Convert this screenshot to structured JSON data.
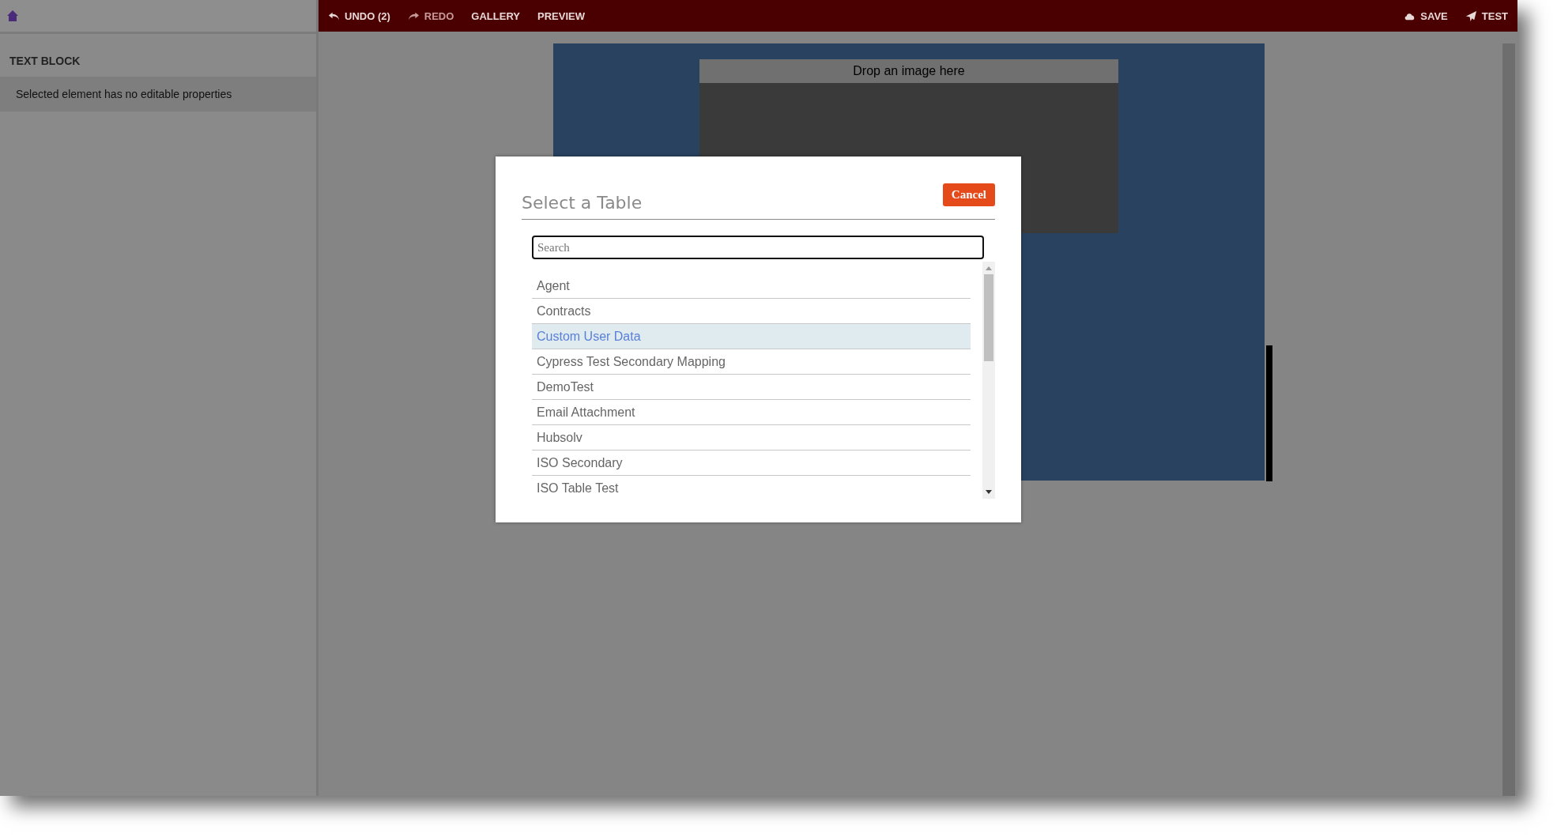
{
  "top_bar": {
    "items": [
      {
        "label": "UNDO (2)",
        "kind": "undo",
        "disabled": false
      },
      {
        "label": "REDO",
        "kind": "redo",
        "disabled": true
      },
      {
        "label": "GALLERY",
        "kind": "plain",
        "disabled": false
      },
      {
        "label": "PREVIEW",
        "kind": "plain",
        "disabled": false
      }
    ],
    "right_items": [
      {
        "label": "SAVE",
        "kind": "save"
      },
      {
        "label": "TEST",
        "kind": "send"
      }
    ]
  },
  "properties_panel": {
    "title": "TEXT BLOCK",
    "message": "Selected element has no editable properties"
  },
  "canvas": {
    "image_drop": "Drop an image here"
  },
  "dialog": {
    "title": "Select a Table",
    "cancel": "Cancel",
    "search": {
      "placeholder": "Search"
    },
    "tables": [
      {
        "name": "Agent",
        "selected": false
      },
      {
        "name": "Contracts",
        "selected": false
      },
      {
        "name": "Custom User Data",
        "selected": true
      },
      {
        "name": "Cypress Test Secondary Mapping",
        "selected": false
      },
      {
        "name": "DemoTest",
        "selected": false
      },
      {
        "name": "Email Attachment",
        "selected": false
      },
      {
        "name": "Hubsolv",
        "selected": false
      },
      {
        "name": "ISO Secondary",
        "selected": false
      },
      {
        "name": "ISO Table Test",
        "selected": false
      }
    ]
  }
}
